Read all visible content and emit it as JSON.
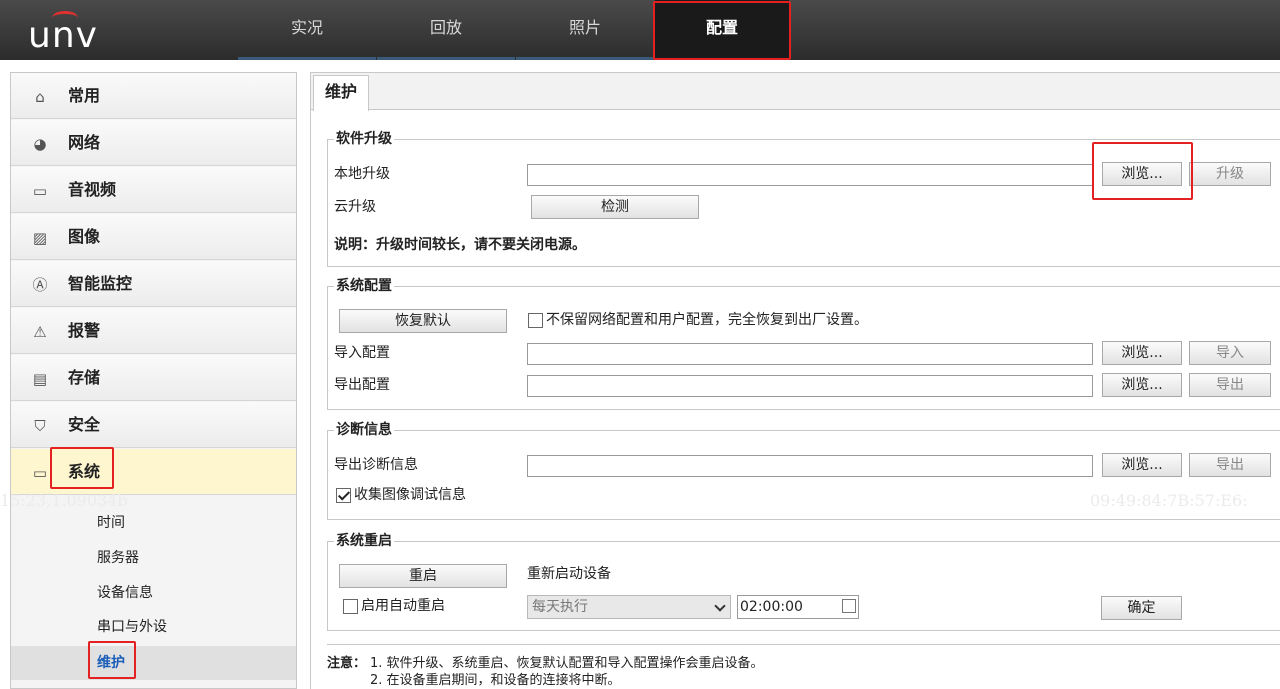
{
  "brand": {
    "logo_text": "unv"
  },
  "nav": {
    "tabs": [
      {
        "label": "实况"
      },
      {
        "label": "回放"
      },
      {
        "label": "照片"
      },
      {
        "label": "配置",
        "active": true
      }
    ]
  },
  "sidebar": {
    "items": [
      {
        "label": "常用",
        "icon": "home-icon"
      },
      {
        "label": "网络",
        "icon": "globe-icon"
      },
      {
        "label": "音视频",
        "icon": "film-icon"
      },
      {
        "label": "图像",
        "icon": "image-icon"
      },
      {
        "label": "智能监控",
        "icon": "smart-icon"
      },
      {
        "label": "报警",
        "icon": "warning-icon"
      },
      {
        "label": "存储",
        "icon": "storage-icon"
      },
      {
        "label": "安全",
        "icon": "shield-icon"
      },
      {
        "label": "系统",
        "icon": "window-icon",
        "active": true
      }
    ],
    "sub_items": [
      {
        "label": "时间"
      },
      {
        "label": "服务器"
      },
      {
        "label": "设备信息"
      },
      {
        "label": "串口与外设"
      },
      {
        "label": "维护",
        "active": true
      }
    ]
  },
  "watermarks": {
    "left": "15:23,1.09034b",
    "right": "09:49:84:7B:57:E6:"
  },
  "content": {
    "tab_label": "维护",
    "upgrade": {
      "legend": "软件升级",
      "local_label": "本地升级",
      "local_value": "",
      "browse_label": "浏览...",
      "upgrade_label": "升级",
      "cloud_label": "云升级",
      "detect_label": "检测",
      "note": "说明：升级时间较长，请不要关闭电源。"
    },
    "config": {
      "legend": "系统配置",
      "restore_label": "恢复默认",
      "full_restore_label": "不保留网络配置和用户配置，完全恢复到出厂设置。",
      "full_restore_checked": false,
      "import_label": "导入配置",
      "import_value": "",
      "import_browse": "浏览...",
      "import_button": "导入",
      "export_label": "导出配置",
      "export_value": "",
      "export_browse": "浏览...",
      "export_button": "导出"
    },
    "diagnosis": {
      "legend": "诊断信息",
      "export_label": "导出诊断信息",
      "export_value": "",
      "browse_label": "浏览...",
      "export_button": "导出",
      "collect_label": "收集图像调试信息",
      "collect_checked": true
    },
    "reboot": {
      "legend": "系统重启",
      "reboot_label": "重启",
      "reboot_desc": "重新启动设备",
      "auto_label": "启用自动重启",
      "auto_checked": false,
      "schedule_value": "每天执行",
      "time_value": "02:00:00",
      "confirm_label": "确定"
    },
    "notes": {
      "prefix": "注意：",
      "line1": "1. 软件升级、系统重启、恢复默认配置和导入配置操作会重启设备。",
      "line2": "2. 在设备重启期间，和设备的连接将中断。"
    }
  }
}
